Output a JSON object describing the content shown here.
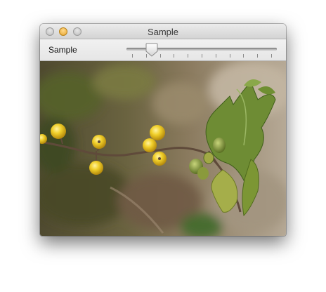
{
  "window": {
    "title": "Sample",
    "controls": [
      "close-button",
      "minimize-button",
      "zoom-button"
    ]
  },
  "toolbar": {
    "label": "Sample",
    "slider": {
      "value_fraction": 0.14,
      "tick_count": 11
    }
  },
  "image": {
    "icon": "plant-photo"
  }
}
